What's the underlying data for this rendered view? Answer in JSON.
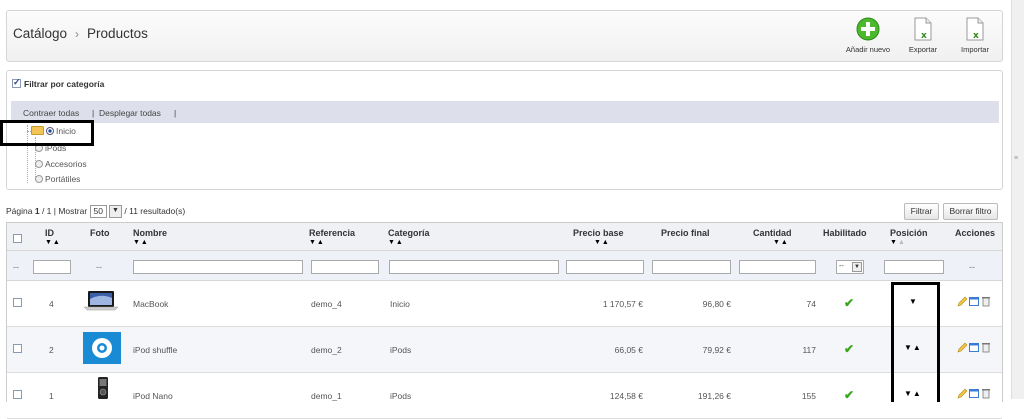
{
  "breadcrumb": {
    "parent": "Catálogo",
    "separator": "›",
    "current": "Productos"
  },
  "toolbar": {
    "add_label": "Añadir nuevo",
    "export_label": "Exportar",
    "import_label": "Importar"
  },
  "filter": {
    "title": "Filtrar por categoría",
    "collapse_all": "Contraer todas",
    "expand_all": "Desplegar todas",
    "sep": "|",
    "tree": [
      "Inicio",
      "iPods",
      "Accesorios",
      "Portátiles"
    ]
  },
  "pagination": {
    "page_prefix": "Página",
    "page_current": "1",
    "page_total": "/ 1",
    "show_label": "| Mostrar",
    "per_page": "50",
    "results": "/ 11 resultado(s)"
  },
  "buttons": {
    "filter": "Filtrar",
    "clear": "Borrar filtro"
  },
  "columns": {
    "id": "ID",
    "photo": "Foto",
    "name": "Nombre",
    "reference": "Referencia",
    "category": "Categoría",
    "base_price": "Precio base",
    "final_price": "Precio final",
    "quantity": "Cantidad",
    "enabled": "Habilitado",
    "position": "Posición",
    "actions": "Acciones"
  },
  "filter_row": {
    "dash": "--",
    "enabled_value": "--"
  },
  "rows": [
    {
      "id": "4",
      "name": "MacBook",
      "reference": "demo_4",
      "category": "Inicio",
      "base_price": "1 170,57 €",
      "final_price": "96,80 €",
      "quantity": "74",
      "enabled": "✔",
      "position": "▼"
    },
    {
      "id": "2",
      "name": "iPod shuffle",
      "reference": "demo_2",
      "category": "iPods",
      "base_price": "66,05 €",
      "final_price": "79,92 €",
      "quantity": "117",
      "enabled": "✔",
      "position": "▼▲"
    },
    {
      "id": "1",
      "name": "iPod Nano",
      "reference": "demo_1",
      "category": "iPods",
      "base_price": "124,58 €",
      "final_price": "191,26 €",
      "quantity": "155",
      "enabled": "✔",
      "position": "▼▲"
    }
  ],
  "sort_arrows": "▼▲",
  "colors": {
    "check_green": "#3aa51e",
    "header_bg": "#f0f1f5",
    "filter_bar": "#dde0ea"
  },
  "icons": [
    "add-icon",
    "export-icon",
    "import-icon",
    "folder-icon",
    "edit-icon",
    "duplicate-icon",
    "delete-icon",
    "check-icon",
    "sort-arrows-icon"
  ]
}
